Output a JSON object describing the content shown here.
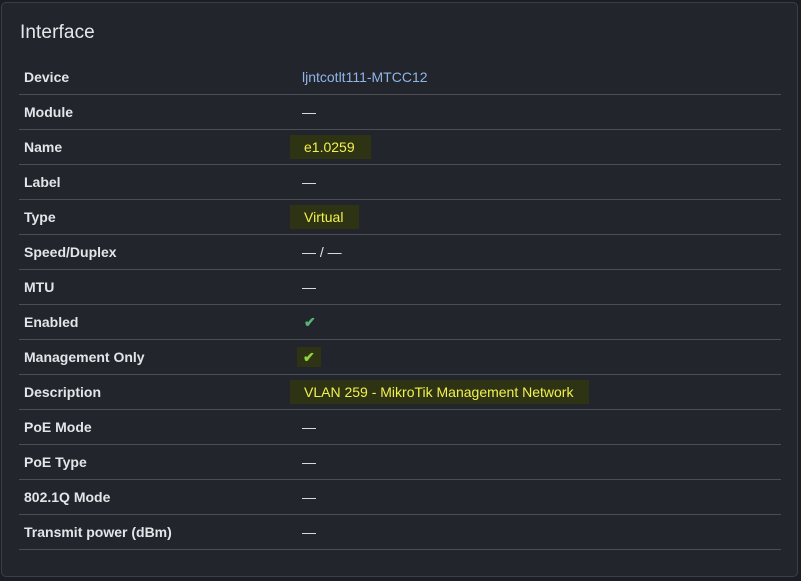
{
  "card": {
    "title": "Interface"
  },
  "rows": [
    {
      "label": "Device",
      "value": "ljntcotlt111-MTCC12"
    },
    {
      "label": "Module",
      "value": "—"
    },
    {
      "label": "Name",
      "value": "e1.0259"
    },
    {
      "label": "Label",
      "value": "—"
    },
    {
      "label": "Type",
      "value": "Virtual"
    },
    {
      "label": "Speed/Duplex",
      "value": "— / —"
    },
    {
      "label": "MTU",
      "value": "—"
    },
    {
      "label": "Enabled",
      "value": "✔"
    },
    {
      "label": "Management Only",
      "value": "✔"
    },
    {
      "label": "Description",
      "value": "VLAN 259 - MikroTik Management Network"
    },
    {
      "label": "PoE Mode",
      "value": "—"
    },
    {
      "label": "PoE Type",
      "value": "—"
    },
    {
      "label": "802.1Q Mode",
      "value": "—"
    },
    {
      "label": "Transmit power (dBm)",
      "value": "—"
    }
  ],
  "colors": {
    "background": "#22262c",
    "link": "#8fb4e8",
    "highlight_bg": "#2e3313",
    "highlight_text": "#f1f150",
    "check": "#56b47a"
  },
  "icons": {
    "enabled": "checkmark-icon",
    "management_only": "checkmark-icon"
  }
}
